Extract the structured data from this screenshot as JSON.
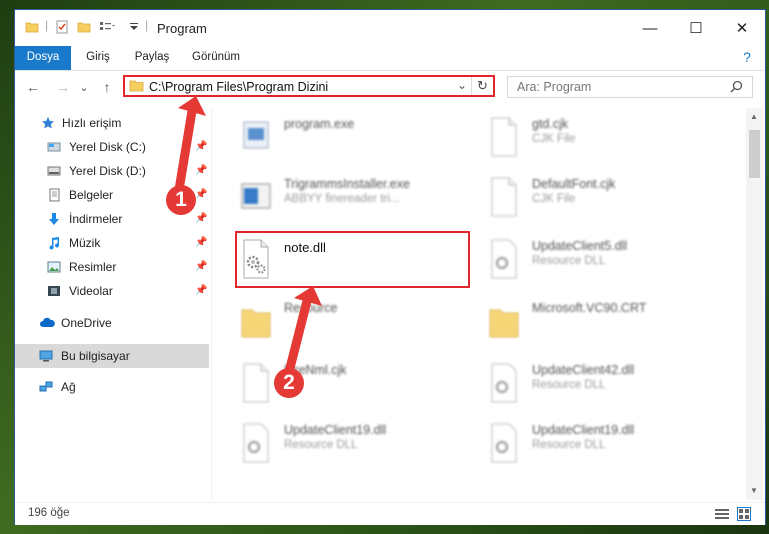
{
  "window": {
    "title": "Program",
    "minimize": "—",
    "maximize": "☐",
    "close": "✕"
  },
  "ribbon": {
    "tabs": [
      {
        "label": "Dosya",
        "active": true
      },
      {
        "label": "Giriş",
        "active": false
      },
      {
        "label": "Paylaş",
        "active": false
      },
      {
        "label": "Görünüm",
        "active": false
      }
    ],
    "help": "?"
  },
  "nav": {
    "back": "←",
    "forward": "→",
    "recent": "⌄",
    "up": "↑",
    "address": "C:\\Program Files\\Program Dizini",
    "address_dropdown": "⌄",
    "refresh": "↻",
    "search_placeholder": "Ara: Program",
    "search_icon": "search-icon"
  },
  "sidebar": {
    "items": [
      {
        "label": "Hızlı erişim",
        "icon": "star-icon",
        "pinned": false,
        "selected": false
      },
      {
        "label": "Yerel Disk (C:)",
        "icon": "drive-icon",
        "pinned": true,
        "selected": false
      },
      {
        "label": "Yerel Disk (D:)",
        "icon": "drive-icon",
        "pinned": true,
        "selected": false
      },
      {
        "label": "Belgeler",
        "icon": "documents-icon",
        "pinned": true,
        "selected": false
      },
      {
        "label": "İndirmeler",
        "icon": "download-icon",
        "pinned": true,
        "selected": false
      },
      {
        "label": "Müzik",
        "icon": "music-icon",
        "pinned": true,
        "selected": false
      },
      {
        "label": "Resimler",
        "icon": "pictures-icon",
        "pinned": true,
        "selected": false
      },
      {
        "label": "Videolar",
        "icon": "videos-icon",
        "pinned": true,
        "selected": false
      },
      {
        "label": "OneDrive",
        "icon": "cloud-icon",
        "pinned": false,
        "selected": false
      },
      {
        "label": "Bu bilgisayar",
        "icon": "computer-icon",
        "pinned": false,
        "selected": true
      },
      {
        "label": "Ağ",
        "icon": "network-icon",
        "pinned": false,
        "selected": false
      }
    ]
  },
  "files": [
    {
      "name": "program.exe",
      "type": "",
      "icon": "exe-icon"
    },
    {
      "name": "gtd.cjk",
      "type": "CJK File",
      "icon": "blank-file-icon"
    },
    {
      "name": "TrigrammsInstaller.exe",
      "type": "ABBYY finereader tri...",
      "icon": "installer-icon"
    },
    {
      "name": "DefaultFont.cjk",
      "type": "CJK File",
      "icon": "blank-file-icon"
    },
    {
      "name": "note.dll",
      "type": "",
      "icon": "dll-gear-icon"
    },
    {
      "name": "UpdateClient5.dll",
      "type": "Resource DLL",
      "icon": "dll-gear-icon"
    },
    {
      "name": "Resource",
      "type": "",
      "icon": "folder-icon"
    },
    {
      "name": "Microsoft.VC90.CRT",
      "type": "",
      "icon": "folder-icon"
    },
    {
      "name": "FireNml.cjk",
      "type": "",
      "icon": "blank-file-icon"
    },
    {
      "name": "UpdateClient42.dll",
      "type": "Resource DLL",
      "icon": "dll-gear-icon"
    },
    {
      "name": "UpdateClient19.dll",
      "type": "Resource DLL",
      "icon": "dll-gear-icon"
    },
    {
      "name": "UpdateClient19.dll",
      "type": "Resource DLL",
      "icon": "dll-gear-icon"
    }
  ],
  "status": {
    "count": "196 öğe"
  },
  "callouts": {
    "one": "1",
    "two": "2"
  },
  "colors": {
    "accent": "#1979ca",
    "highlight": "#e0262a",
    "callout": "#e53935",
    "selected": "#d9d9d9"
  }
}
